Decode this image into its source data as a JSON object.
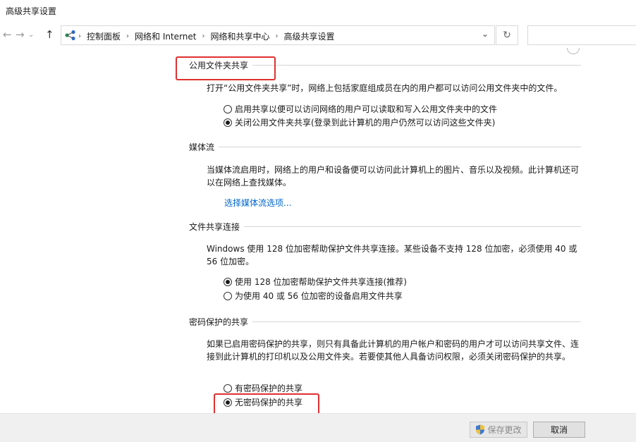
{
  "window": {
    "title": "高级共享设置"
  },
  "toolbar": {
    "back_icon": "arrow-left-icon",
    "forward_icon": "arrow-right-icon",
    "up_icon": "arrow-up-icon",
    "breadcrumbs": [
      "控制面板",
      "网络和 Internet",
      "网络和共享中心",
      "高级共享设置"
    ],
    "dropdown_icon": "chevron-down-icon",
    "refresh_icon": "refresh-icon"
  },
  "sections": {
    "public_folder": {
      "title": "公用文件夹共享",
      "description": "打开“公用文件夹共享”时，网络上包括家庭组成员在内的用户都可以访问公用文件夹中的文件。",
      "options": [
        {
          "label": "启用共享以便可以访问网络的用户可以读取和写入公用文件夹中的文件",
          "checked": false
        },
        {
          "label": "关闭公用文件夹共享(登录到此计算机的用户仍然可以访问这些文件夹)",
          "checked": true
        }
      ]
    },
    "media": {
      "title": "媒体流",
      "description": "当媒体流启用时，网络上的用户和设备便可以访问此计算机上的图片、音乐以及视频。此计算机还可以在网络上查找媒体。",
      "link": "选择媒体流选项..."
    },
    "file_sharing": {
      "title": "文件共享连接",
      "description": "Windows 使用 128 位加密帮助保护文件共享连接。某些设备不支持 128 位加密，必须使用 40 或 56 位加密。",
      "options": [
        {
          "label": "使用 128 位加密帮助保护文件共享连接(推荐)",
          "checked": true
        },
        {
          "label": "为使用 40 或 56 位加密的设备启用文件共享",
          "checked": false
        }
      ]
    },
    "password": {
      "title": "密码保护的共享",
      "description": "如果已启用密码保护的共享，则只有具备此计算机的用户帐户和密码的用户才可以访问共享文件、连接到此计算机的打印机以及公用文件夹。若要使其他人具备访问权限，必须关闭密码保护的共享。",
      "options": [
        {
          "label": "有密码保护的共享",
          "checked": false
        },
        {
          "label": "无密码保护的共享",
          "checked": true
        }
      ]
    }
  },
  "footer": {
    "save_label": "保存更改",
    "save_icon": "uac-shield-icon",
    "cancel_label": "取消"
  },
  "colors": {
    "link": "#0066cc",
    "highlight": "#e03030",
    "footer_bg": "#f0f0f0"
  }
}
